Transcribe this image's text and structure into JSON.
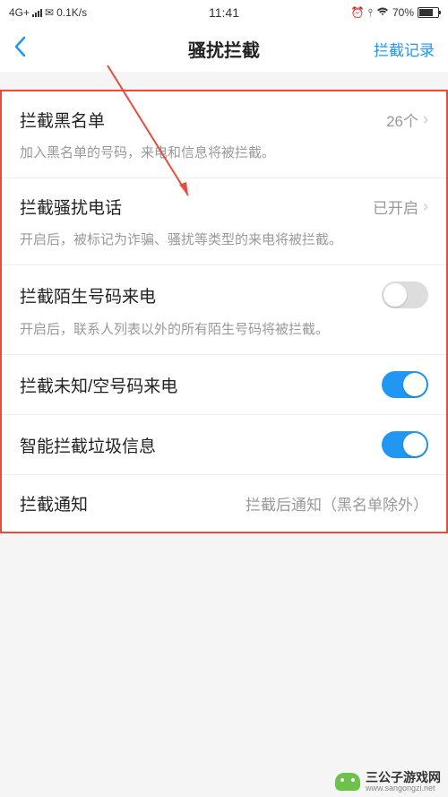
{
  "status_bar": {
    "network": "4G+",
    "speed": "0.1K/s",
    "time": "11:41",
    "battery_pct": "70%"
  },
  "header": {
    "title": "骚扰拦截",
    "action": "拦截记录"
  },
  "items": {
    "blacklist": {
      "label": "拦截黑名单",
      "value": "26个",
      "desc": "加入黑名单的号码，来电和信息将被拦截。"
    },
    "harass": {
      "label": "拦截骚扰电话",
      "value": "已开启",
      "desc": "开启后，被标记为诈骗、骚扰等类型的来电将被拦截。"
    },
    "stranger": {
      "label": "拦截陌生号码来电",
      "desc": "开启后，联系人列表以外的所有陌生号码将被拦截。"
    },
    "unknown": {
      "label": "拦截未知/空号码来电"
    },
    "spam_msg": {
      "label": "智能拦截垃圾信息"
    },
    "notify": {
      "label": "拦截通知",
      "value": "拦截后通知（黑名单除外）"
    }
  },
  "watermark": {
    "name": "三公子游戏网",
    "url": "www.sangongzi.net"
  }
}
